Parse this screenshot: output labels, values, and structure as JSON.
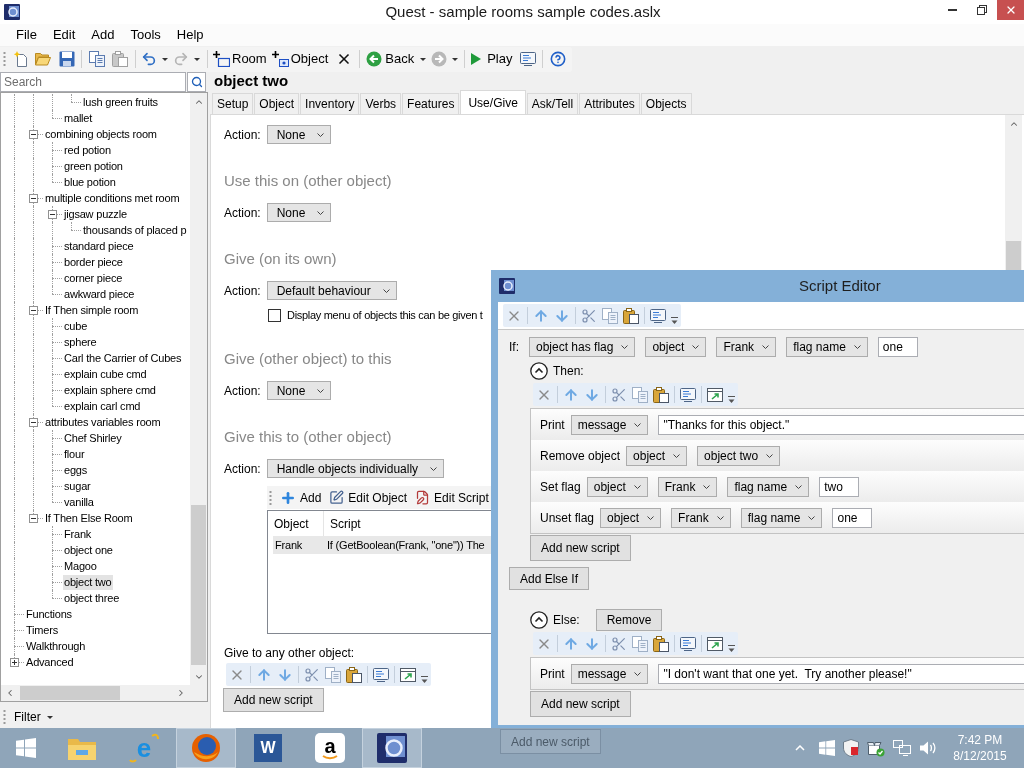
{
  "window": {
    "title": "Quest - sample rooms sample codes.aslx"
  },
  "menu": [
    "File",
    "Edit",
    "Add",
    "Tools",
    "Help"
  ],
  "toolbar": {
    "copy": {
      "disabled": false
    },
    "paste": {
      "disabled": true
    },
    "undo": {
      "disabled": false
    },
    "redo": {
      "disabled": true
    },
    "room": {
      "label": "Room"
    },
    "object": {
      "label": "Object"
    },
    "back": {
      "label": "Back",
      "disabled": false
    },
    "forward": {
      "disabled": true
    },
    "play": {
      "label": "Play"
    }
  },
  "sidebar": {
    "search": {
      "placeholder": "Search"
    },
    "tree": [
      {
        "children": [
          {
            "children": [
              {
                "children": [
                  {
                    "label": "lush green fruits",
                    "selected": false
                  }
                ]
              },
              {
                "label": "mallet",
                "selected": false
              }
            ]
          },
          {
            "label": "combining objects room",
            "selected": false,
            "expanded": true,
            "children": [
              {
                "label": "red potion",
                "selected": false
              },
              {
                "label": "green potion",
                "selected": false
              },
              {
                "label": "blue potion",
                "selected": false
              }
            ]
          },
          {
            "label": "multiple conditions met room",
            "selected": false,
            "expanded": true,
            "children": [
              {
                "label": "jigsaw puzzle",
                "selected": false,
                "expanded": true,
                "children": [
                  {
                    "label": "thousands of placed p",
                    "selected": false
                  }
                ]
              },
              {
                "label": "standard piece",
                "selected": false
              },
              {
                "label": "border piece",
                "selected": false
              },
              {
                "label": "corner piece",
                "selected": false
              },
              {
                "label": "awkward piece",
                "selected": false
              }
            ]
          },
          {
            "label": "If Then simple room",
            "selected": false,
            "expanded": true,
            "children": [
              {
                "label": "cube",
                "selected": false
              },
              {
                "label": "sphere",
                "selected": false
              },
              {
                "label": "Carl the Carrier of Cubes",
                "selected": false
              },
              {
                "label": "explain cube cmd",
                "selected": false
              },
              {
                "label": "explain sphere cmd",
                "selected": false
              },
              {
                "label": "explain carl cmd",
                "selected": false
              }
            ]
          },
          {
            "label": "attributes variables room",
            "selected": false,
            "expanded": true,
            "children": [
              {
                "label": "Chef Shirley",
                "selected": false
              },
              {
                "label": "flour",
                "selected": false
              },
              {
                "label": "eggs",
                "selected": false
              },
              {
                "label": "sugar",
                "selected": false
              },
              {
                "label": "vanilla",
                "selected": false
              }
            ]
          },
          {
            "label": "If Then Else Room",
            "selected": false,
            "expanded": true,
            "children": [
              {
                "label": "Frank",
                "selected": false
              },
              {
                "label": "object one",
                "selected": false
              },
              {
                "label": "Magoo",
                "selected": false
              },
              {
                "label": "object two",
                "selected": true
              },
              {
                "label": "object three",
                "selected": false
              }
            ]
          }
        ]
      },
      {
        "label": "Functions",
        "selected": false
      },
      {
        "label": "Timers",
        "selected": false
      },
      {
        "label": "Walkthrough",
        "selected": false
      },
      {
        "label": "Advanced",
        "selected": false,
        "expanded": false
      }
    ],
    "filter": "Filter"
  },
  "editor": {
    "title": "object two",
    "tabs": [
      {
        "label": "Setup",
        "selected": false
      },
      {
        "label": "Object",
        "selected": false
      },
      {
        "label": "Inventory",
        "selected": false
      },
      {
        "label": "Verbs",
        "selected": false
      },
      {
        "label": "Features",
        "selected": false
      },
      {
        "label": "Use/Give",
        "selected": true
      },
      {
        "label": "Ask/Tell",
        "selected": false
      },
      {
        "label": "Attributes",
        "selected": false
      },
      {
        "label": "Objects",
        "selected": false
      }
    ],
    "use_action": {
      "label": "Action:",
      "value": "None"
    },
    "sections": [
      {
        "heading": "Use this on (other object)",
        "action": {
          "label": "Action:",
          "value": "None"
        }
      },
      {
        "heading": "Give (on its own)",
        "action": {
          "label": "Action:",
          "value": "Default behaviour"
        },
        "checkbox": {
          "label": "Display menu of objects this can be given t",
          "checked": false
        }
      },
      {
        "heading": "Give (other object) to this",
        "action": {
          "label": "Action:",
          "value": "None"
        }
      },
      {
        "heading": "Give this to (other object)",
        "action": {
          "label": "Action:",
          "value": "Handle objects individually"
        },
        "list": {
          "toolbar": [
            {
              "kind": "add",
              "label": "Add"
            },
            {
              "kind": "edit_object",
              "label": "Edit Object"
            },
            {
              "kind": "edit_script",
              "label": "Edit Script"
            }
          ],
          "columns": [
            "Object",
            "Script"
          ],
          "rows": [
            {
              "cells": [
                "Frank",
                "If (GetBoolean(Frank, \"one\")) The"
              ],
              "selected": true
            }
          ]
        }
      }
    ],
    "other_object": {
      "label": "Give to any other object:",
      "add_button": "Add new script"
    }
  },
  "script_editor": {
    "title": "Script Editor",
    "if": {
      "label": "If:",
      "params": [
        {
          "kind": "dropdown",
          "value": "object has flag"
        },
        {
          "kind": "dropdown",
          "value": "object"
        },
        {
          "kind": "dropdown",
          "value": "Frank"
        },
        {
          "kind": "dropdown",
          "value": "flag name"
        },
        {
          "kind": "text",
          "value": "one"
        }
      ]
    },
    "then": {
      "label": "Then:",
      "expanded": true,
      "scripts": [
        {
          "label": "Print",
          "params": [
            {
              "kind": "dropdown",
              "value": "message"
            },
            {
              "kind": "expression",
              "value": "\"Thanks for this object.\""
            }
          ]
        },
        {
          "label": "Remove object",
          "params": [
            {
              "kind": "dropdown",
              "value": "object"
            },
            {
              "kind": "dropdown",
              "value": "object two"
            }
          ]
        },
        {
          "label": "Set flag",
          "params": [
            {
              "kind": "dropdown",
              "value": "object"
            },
            {
              "kind": "dropdown",
              "value": "Frank"
            },
            {
              "kind": "dropdown",
              "value": "flag name"
            },
            {
              "kind": "text",
              "value": "two"
            }
          ]
        },
        {
          "label": "Unset flag",
          "params": [
            {
              "kind": "dropdown",
              "value": "object"
            },
            {
              "kind": "dropdown",
              "value": "Frank"
            },
            {
              "kind": "dropdown",
              "value": "flag name"
            },
            {
              "kind": "text",
              "value": "one"
            }
          ]
        }
      ],
      "add_button": "Add new script"
    },
    "add_else_if_button": "Add Else If",
    "else": {
      "label": "Else:",
      "expanded": true,
      "remove_button": "Remove",
      "scripts": [
        {
          "label": "Print",
          "params": [
            {
              "kind": "dropdown",
              "value": "message"
            },
            {
              "kind": "expression",
              "value": "\"I don't want that one yet.  Try another please!\""
            }
          ]
        }
      ],
      "add_button": "Add new script"
    },
    "outer_add_button": "Add new script"
  },
  "taskbar": {
    "apps": [
      {
        "kind": "explorer",
        "active": false
      },
      {
        "kind": "ie",
        "glyph": "e",
        "active": false
      },
      {
        "kind": "firefox",
        "active": true
      },
      {
        "kind": "word",
        "glyph": "W",
        "active": false
      },
      {
        "kind": "amazon",
        "glyph": "a",
        "active": false
      },
      {
        "kind": "quest",
        "active": true
      }
    ],
    "time": "7:42 PM",
    "date": "8/12/2015"
  }
}
